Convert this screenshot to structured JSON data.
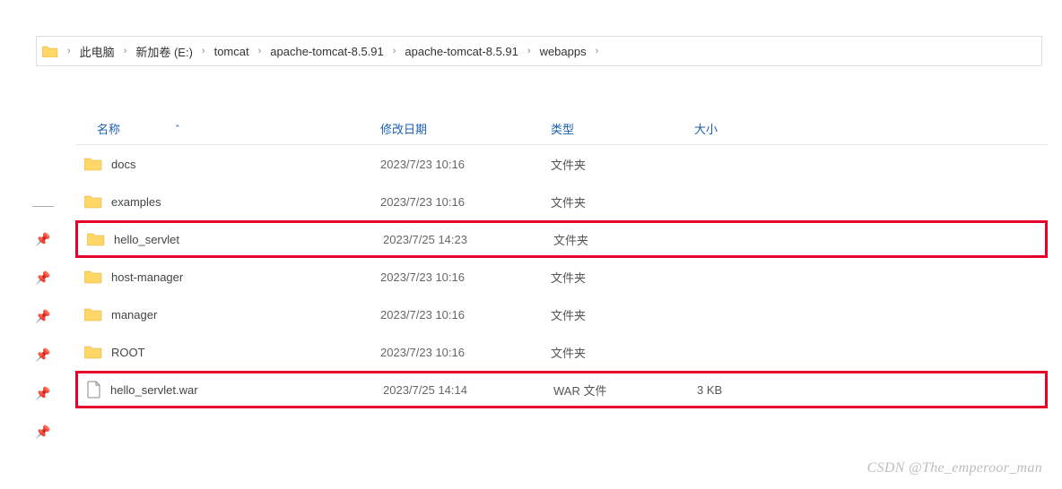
{
  "breadcrumb": {
    "items": [
      "此电脑",
      "新加卷 (E:)",
      "tomcat",
      "apache-tomcat-8.5.91",
      "apache-tomcat-8.5.91",
      "webapps"
    ]
  },
  "columns": {
    "name": "名称",
    "date": "修改日期",
    "type": "类型",
    "size": "大小"
  },
  "rows": [
    {
      "icon": "folder",
      "name": "docs",
      "date": "2023/7/23 10:16",
      "type": "文件夹",
      "size": "",
      "highlight": false
    },
    {
      "icon": "folder",
      "name": "examples",
      "date": "2023/7/23 10:16",
      "type": "文件夹",
      "size": "",
      "highlight": false
    },
    {
      "icon": "folder",
      "name": "hello_servlet",
      "date": "2023/7/25 14:23",
      "type": "文件夹",
      "size": "",
      "highlight": true
    },
    {
      "icon": "folder",
      "name": "host-manager",
      "date": "2023/7/23 10:16",
      "type": "文件夹",
      "size": "",
      "highlight": false
    },
    {
      "icon": "folder",
      "name": "manager",
      "date": "2023/7/23 10:16",
      "type": "文件夹",
      "size": "",
      "highlight": false
    },
    {
      "icon": "folder",
      "name": "ROOT",
      "date": "2023/7/23 10:16",
      "type": "文件夹",
      "size": "",
      "highlight": false
    },
    {
      "icon": "file",
      "name": "hello_servlet.war",
      "date": "2023/7/25 14:14",
      "type": "WAR 文件",
      "size": "3 KB",
      "highlight": true
    }
  ],
  "watermark": "CSDN @The_emperoor_man"
}
